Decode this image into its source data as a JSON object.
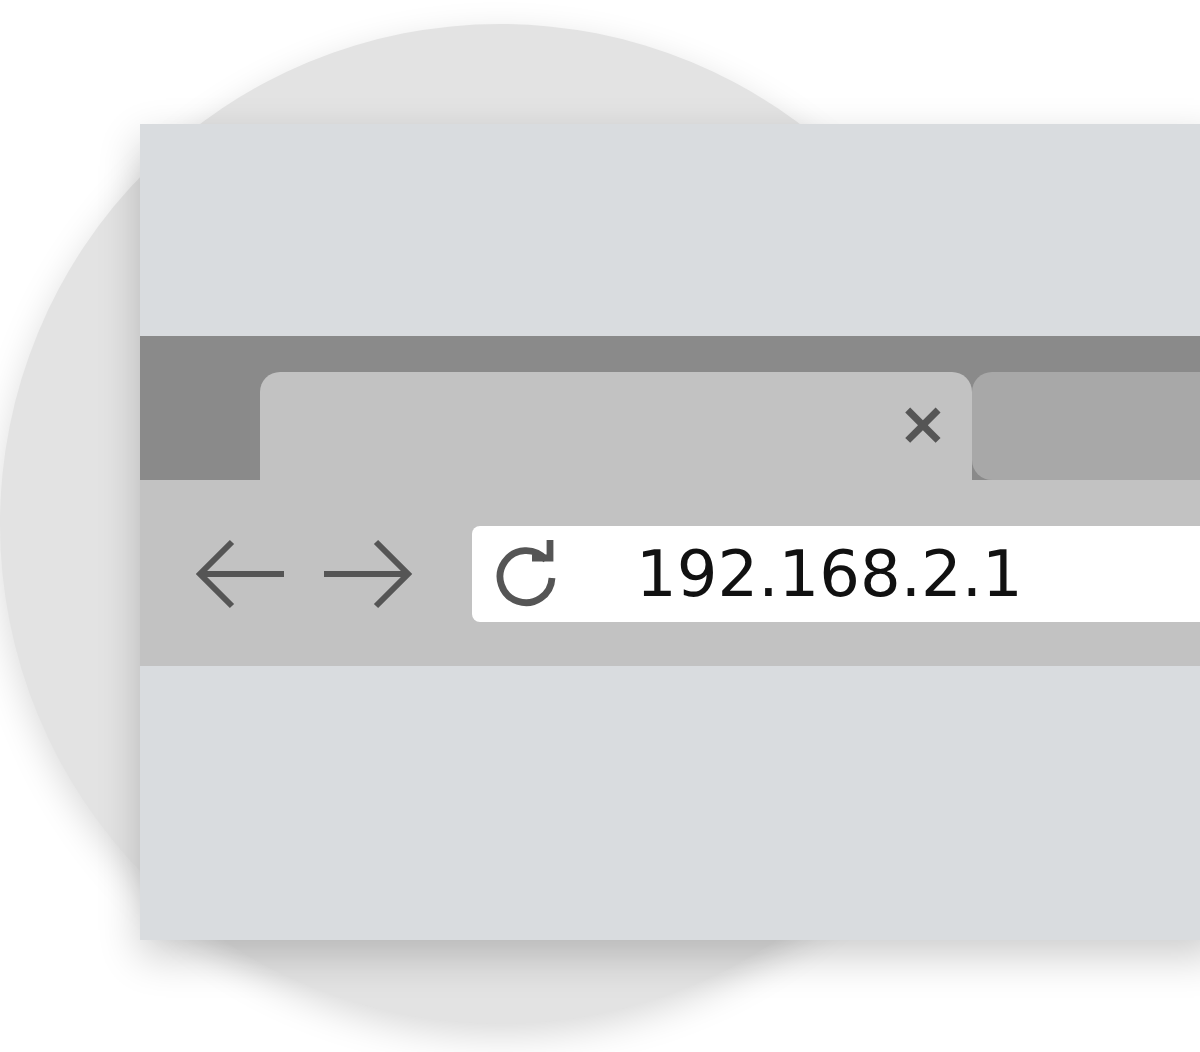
{
  "tabs": [
    {
      "selected": true,
      "close_label": "×"
    },
    {
      "selected": false
    }
  ],
  "address_bar": {
    "value": "192.168.2.1"
  }
}
